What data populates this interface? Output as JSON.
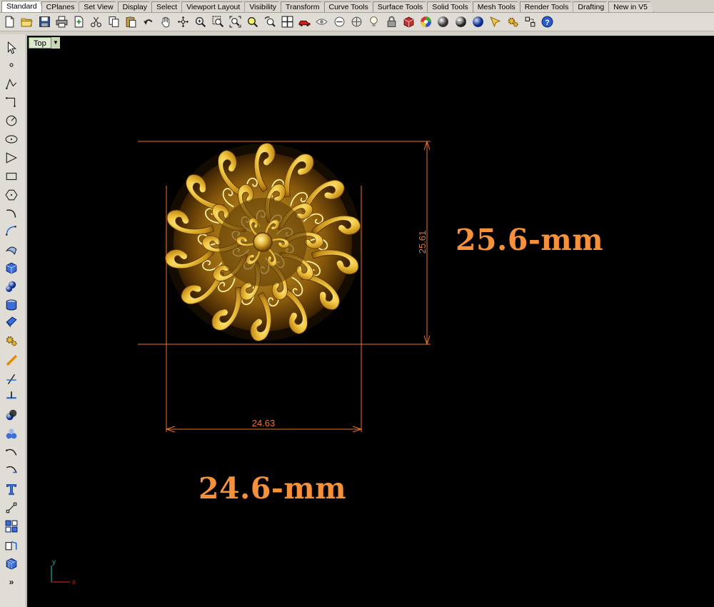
{
  "tabs": [
    "Standard",
    "CPlanes",
    "Set View",
    "Display",
    "Select",
    "Viewport Layout",
    "Visibility",
    "Transform",
    "Curve Tools",
    "Surface Tools",
    "Solid Tools",
    "Mesh Tools",
    "Render Tools",
    "Drafting",
    "New in V5"
  ],
  "active_tab": "Standard",
  "toolbar_icons": [
    "new-file",
    "open-file",
    "save",
    "print",
    "import",
    "cut",
    "copy",
    "paste",
    "undo",
    "pan-hand",
    "rotate-view",
    "zoom-dynamic",
    "zoom-window",
    "zoom-extents",
    "zoom-selected",
    "undo-view",
    "four-viewports",
    "car-object",
    "hide-object",
    "isolate",
    "bulb",
    "lock",
    "render-material",
    "color-wheel",
    "shaded-sphere",
    "rendered-sphere",
    "blue-sphere",
    "dimension-tool",
    "gear-settings",
    "grid-snap",
    "help"
  ],
  "left_toolbar_icons": [
    "select-arrow",
    "point",
    "polyline",
    "line",
    "circle",
    "ellipse",
    "polygon",
    "rectangle",
    "polygon-center",
    "curve",
    "freeform-curve",
    "surface-from-curves",
    "solid-box",
    "sphere-cone",
    "cylinder",
    "extrude-surface",
    "gear",
    "fillet",
    "trim",
    "split",
    "boolean",
    "join-parts",
    "arc",
    "arc-blend",
    "text-tool",
    "grip",
    "array",
    "block",
    "mesh-box",
    "more"
  ],
  "viewport": {
    "label": "Top",
    "dimension_vertical": "25.61",
    "dimension_horizontal": "24.63",
    "label_height": "25.6-mm",
    "label_width": "24.6-mm",
    "axis_x": "x",
    "axis_y": "y"
  },
  "colors": {
    "dimension": "#e8742a",
    "label": "#f5913a",
    "gold_light": "#f6dc6a",
    "gold_mid": "#d9a82a",
    "gold_dark": "#7a4e08",
    "viewport_bg": "#000000"
  }
}
